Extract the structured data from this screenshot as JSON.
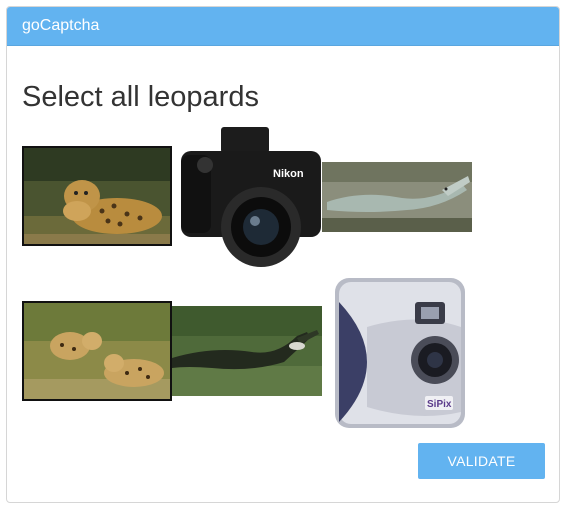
{
  "header": {
    "title": "goCaptcha"
  },
  "prompt": "Select all leopards",
  "images": [
    {
      "subject": "leopard",
      "selected": true
    },
    {
      "subject": "camera",
      "brand_text": "Nikon",
      "selected": false
    },
    {
      "subject": "crocodile",
      "selected": false
    },
    {
      "subject": "leopard",
      "selected": true
    },
    {
      "subject": "crocodile",
      "selected": false
    },
    {
      "subject": "camera",
      "brand_text": "SiPix",
      "selected": false
    }
  ],
  "validate_button": {
    "label": "VALIDATE"
  },
  "colors": {
    "accent": "#62b3f0",
    "text": "#333333"
  }
}
